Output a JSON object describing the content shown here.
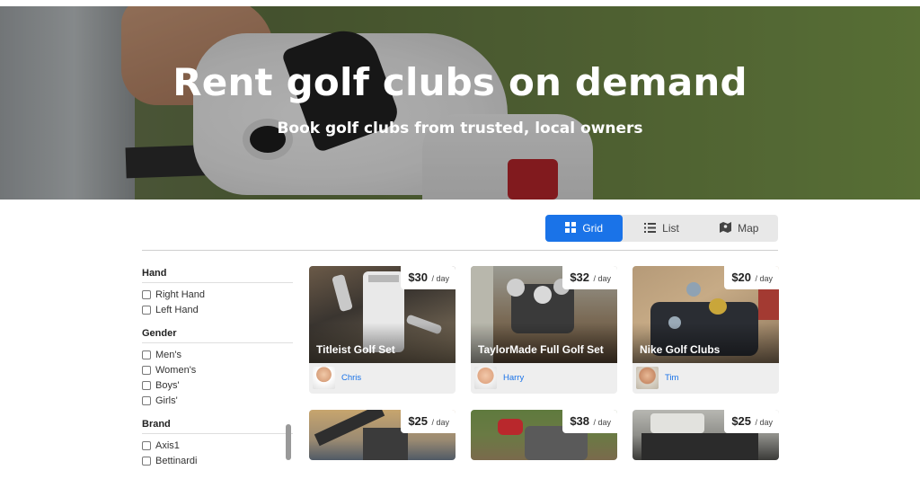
{
  "hero": {
    "title": "Rent golf clubs on demand",
    "subtitle": "Book golf clubs from trusted, local owners"
  },
  "view_toggle": {
    "options": [
      {
        "label": "Grid",
        "icon": "grid-icon",
        "active": true
      },
      {
        "label": "List",
        "icon": "list-icon",
        "active": false
      },
      {
        "label": "Map",
        "icon": "map-icon",
        "active": false
      }
    ]
  },
  "filters": {
    "hand": {
      "heading": "Hand",
      "options": [
        "Right Hand",
        "Left Hand"
      ]
    },
    "gender": {
      "heading": "Gender",
      "options": [
        "Men's",
        "Women's",
        "Boys'",
        "Girls'"
      ]
    },
    "brand": {
      "heading": "Brand",
      "options": [
        "Axis1",
        "Bettinardi"
      ]
    }
  },
  "listings": [
    {
      "title": "Titleist Golf Set",
      "price": "$30",
      "unit": "/ day",
      "owner": "Chris"
    },
    {
      "title": "TaylorMade Full Golf Set",
      "price": "$32",
      "unit": "/ day",
      "owner": "Harry"
    },
    {
      "title": "Nike Golf Clubs",
      "price": "$20",
      "unit": "/ day",
      "owner": "Tim"
    },
    {
      "title": "",
      "price": "$25",
      "unit": "/ day",
      "owner": ""
    },
    {
      "title": "",
      "price": "$38",
      "unit": "/ day",
      "owner": ""
    },
    {
      "title": "",
      "price": "$25",
      "unit": "/ day",
      "owner": ""
    }
  ],
  "colors": {
    "accent": "#1a73e8",
    "toggle_bg": "#e8e8e8",
    "card_bg": "#eeeeee"
  }
}
